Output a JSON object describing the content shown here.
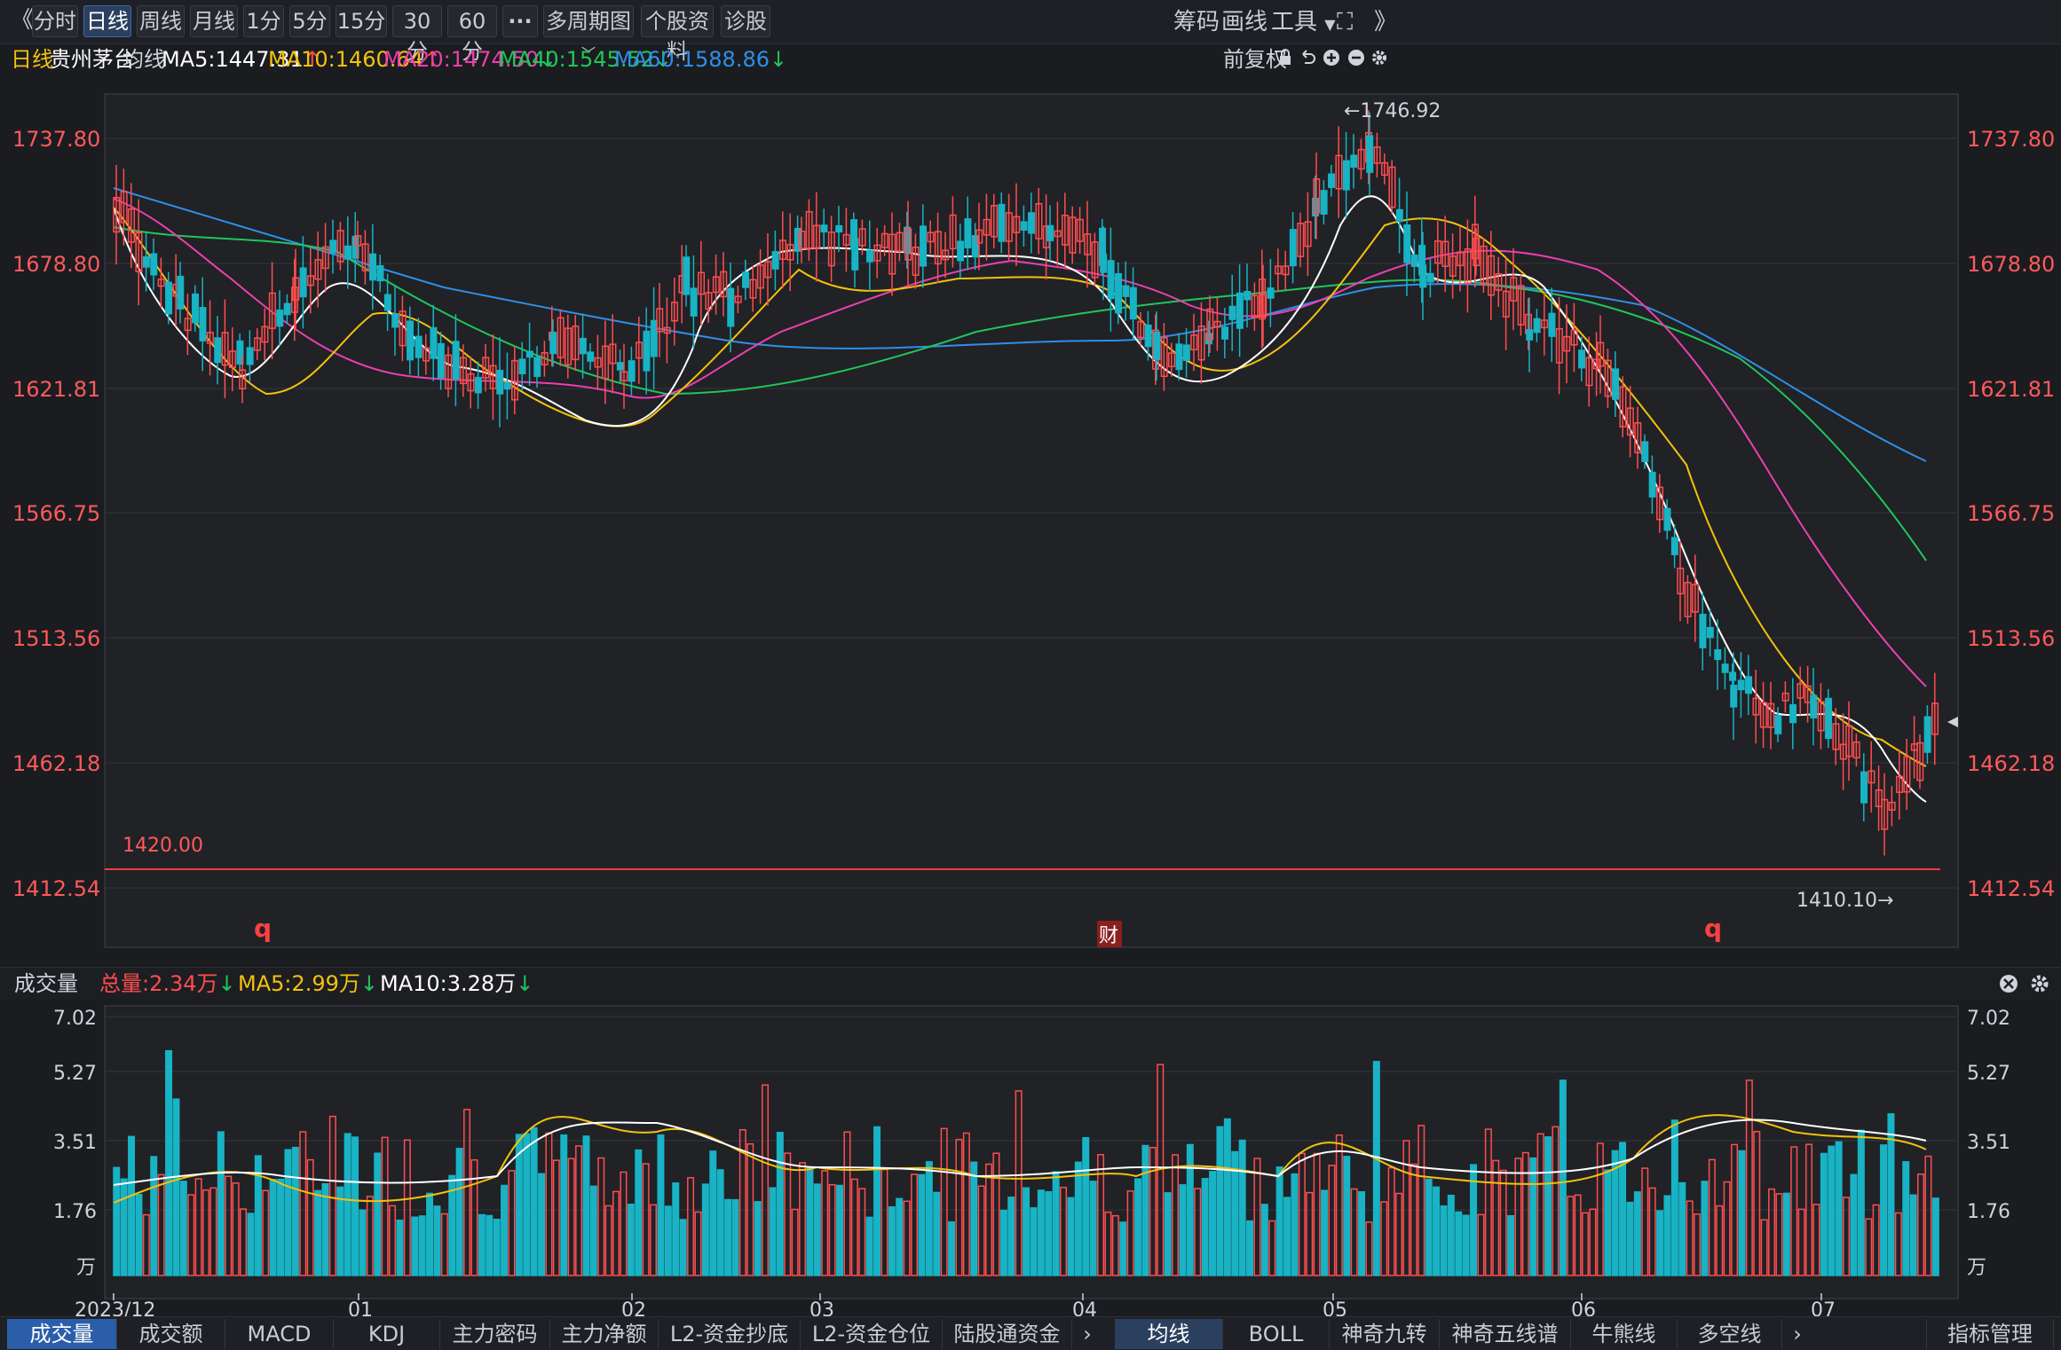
{
  "toolbar": {
    "back": "《",
    "periods": [
      "分时",
      "日线",
      "周线",
      "月线",
      "1分",
      "5分",
      "15分",
      "30分",
      "60分"
    ],
    "active_period": "日线",
    "more": "···",
    "multi_period": "多周期图",
    "stock_info": "个股资料",
    "diagnose": "诊股",
    "chips": "筹码",
    "draw": "画线",
    "tools": "工具",
    "expand": "⛶",
    "forward": "》"
  },
  "info": {
    "period": "日线",
    "stock_name": "贵州茅台",
    "ma_label": "均线",
    "ma5": "MA5:1447.31",
    "ma10": "MA10:1460.64",
    "ma20": "MA20:1474.50",
    "ma40": "MA40:1545.52",
    "ma60": "MA60:1588.86",
    "adjust": "前复权",
    "lock_icon": "lock-icon",
    "undo_icon": "undo-icon",
    "zoom_in_icon": "plus-circle-icon",
    "zoom_out_icon": "minus-circle-icon",
    "settings_icon": "gear-icon"
  },
  "price_axis": [
    "1737.80",
    "1678.80",
    "1621.81",
    "1566.75",
    "1513.56",
    "1462.18",
    "1412.54"
  ],
  "annotations": {
    "high": "←1746.92",
    "low": "1410.10→",
    "line_level": "1420.00",
    "marker_q": "q",
    "marker_cai": "财"
  },
  "volume": {
    "title": "成交量",
    "total": "总量:2.34万",
    "ma5": "MA5:2.99万",
    "ma10": "MA10:3.28万",
    "axis": [
      "7.02",
      "5.27",
      "3.51",
      "1.76"
    ],
    "unit": "万"
  },
  "dates": [
    "2023/12",
    "01",
    "02",
    "03",
    "04",
    "05",
    "06",
    "07"
  ],
  "bottom_tabs_left": [
    "成交量",
    "成交额",
    "MACD",
    "KDJ",
    "主力密码",
    "主力净额",
    "L2-资金抄底",
    "L2-资金仓位",
    "陆股通资金"
  ],
  "bottom_tabs_right": [
    "均线",
    "BOLL",
    "神奇九转",
    "神奇五线谱",
    "牛熊线",
    "多空线"
  ],
  "indicator_manage": "指标管理",
  "colors": {
    "up": "#ff4d4f",
    "down": "#18b3c4",
    "ma5": "#ffffff",
    "ma10": "#f4c10d",
    "ma20": "#ec3fb0",
    "ma40": "#20c65a",
    "ma60": "#2f8fe8"
  }
}
